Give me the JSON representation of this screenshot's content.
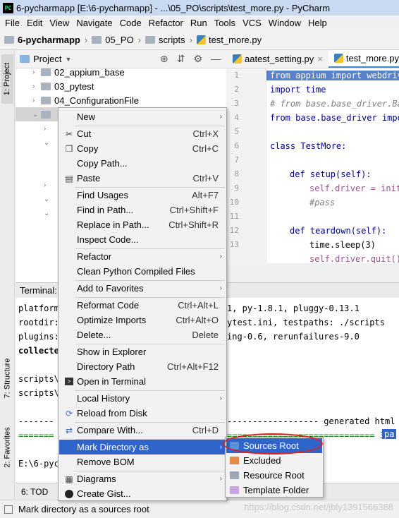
{
  "window": {
    "app_icon": "PC",
    "title": "6-pycharmapp [E:\\6-pycharmapp] - ...\\05_PO\\scripts\\test_more.py - PyCharm"
  },
  "menubar": [
    "File",
    "Edit",
    "View",
    "Navigate",
    "Code",
    "Refactor",
    "Run",
    "Tools",
    "VCS",
    "Window",
    "Help"
  ],
  "breadcrumbs": [
    "6-pycharmapp",
    "05_PO",
    "scripts",
    "test_more.py"
  ],
  "project_panel": {
    "title": "Project"
  },
  "tree": [
    {
      "label": "02_appium_base"
    },
    {
      "label": "03_pytest"
    },
    {
      "label": "04_ConfigurationFile"
    }
  ],
  "editor_tabs": [
    {
      "label": "aatest_setting.py"
    },
    {
      "label": "test_more.py"
    }
  ],
  "line_numbers": [
    "1",
    "2",
    "3",
    "4",
    "5",
    "6",
    "7",
    "8",
    "9",
    "10",
    "11",
    "12",
    "13"
  ],
  "code": {
    "l1": "from appium import webdriv",
    "l2": "import time",
    "l3": "# from base.base_driver.Ba",
    "l4": "from base.base_driver impo",
    "l6": "class TestMore:",
    "l8": "def setup(self):",
    "l9": "self.driver = init",
    "l10": "#pass",
    "l12": "def teardown(self):",
    "l13": "time.sleep(3)",
    "l14": "self.driver.quit()"
  },
  "terminal": {
    "title": "Terminal:",
    "lines": [
      "platform",
      "rootdir:",
      "plugins:",
      "collecte",
      "",
      "scripts\\",
      "scripts\\",
      "",
      "-------",
      "=======",
      "",
      "E:\\6-pyc"
    ],
    "right_lines": [
      "1, py-1.8.1, pluggy-0.13.1",
      "ytest.ini, testpaths: ./scripts",
      "ing-0.6, rerunfailures-9.0",
      "------------------ generated html file",
      "============================= 3"
    ],
    "badge": "pa"
  },
  "left_stripe": [
    "1: Project",
    "7: Structure",
    "2: Favorites"
  ],
  "bottom_tabs": [
    "6: TOD"
  ],
  "status": "Mark directory as a sources root",
  "watermark": "https://blog.csdn.net/jbly1391566388",
  "context_menu": [
    {
      "label": "New",
      "shortcut": "",
      "icon": "",
      "submenu": true
    },
    {
      "label": "Cut",
      "shortcut": "Ctrl+X",
      "icon": "scissors-icon"
    },
    {
      "label": "Copy",
      "shortcut": "Ctrl+C",
      "icon": "copy-icon"
    },
    {
      "label": "Copy Path...",
      "shortcut": "",
      "icon": ""
    },
    {
      "label": "Paste",
      "shortcut": "Ctrl+V",
      "icon": "paste-icon"
    },
    {
      "label": "Find Usages",
      "shortcut": "Alt+F7",
      "icon": ""
    },
    {
      "label": "Find in Path...",
      "shortcut": "Ctrl+Shift+F",
      "icon": ""
    },
    {
      "label": "Replace in Path...",
      "shortcut": "Ctrl+Shift+R",
      "icon": ""
    },
    {
      "label": "Inspect Code...",
      "shortcut": "",
      "icon": ""
    },
    {
      "label": "Refactor",
      "shortcut": "",
      "icon": "",
      "submenu": true
    },
    {
      "label": "Clean Python Compiled Files",
      "shortcut": "",
      "icon": ""
    },
    {
      "label": "Add to Favorites",
      "shortcut": "",
      "icon": "",
      "submenu": true
    },
    {
      "label": "Reformat Code",
      "shortcut": "Ctrl+Alt+L",
      "icon": ""
    },
    {
      "label": "Optimize Imports",
      "shortcut": "Ctrl+Alt+O",
      "icon": ""
    },
    {
      "label": "Delete...",
      "shortcut": "Delete",
      "icon": ""
    },
    {
      "label": "Show in Explorer",
      "shortcut": "",
      "icon": ""
    },
    {
      "label": "Directory Path",
      "shortcut": "Ctrl+Alt+F12",
      "icon": ""
    },
    {
      "label": "Open in Terminal",
      "shortcut": "",
      "icon": "terminal-icon"
    },
    {
      "label": "Local History",
      "shortcut": "",
      "icon": "",
      "submenu": true
    },
    {
      "label": "Reload from Disk",
      "shortcut": "",
      "icon": "reload-icon"
    },
    {
      "label": "Compare With...",
      "shortcut": "Ctrl+D",
      "icon": "compare-icon"
    },
    {
      "label": "Mark Directory as",
      "shortcut": "",
      "icon": "",
      "submenu": true
    },
    {
      "label": "Remove BOM",
      "shortcut": "",
      "icon": ""
    },
    {
      "label": "Diagrams",
      "shortcut": "",
      "icon": "diagrams-icon",
      "submenu": true
    },
    {
      "label": "Create Gist...",
      "shortcut": "",
      "icon": "github-icon"
    }
  ],
  "submenu": [
    {
      "label": "Sources Root",
      "color": "#5b8fd6"
    },
    {
      "label": "Excluded",
      "color": "#e08a4c"
    },
    {
      "label": "Resource Root",
      "color": "#9ca7b3"
    },
    {
      "label": "Template Folder",
      "color": "#c9a5e0"
    }
  ],
  "colors": {
    "selection": "#2f65ca",
    "highlight_ellipse": "#e0201e"
  }
}
